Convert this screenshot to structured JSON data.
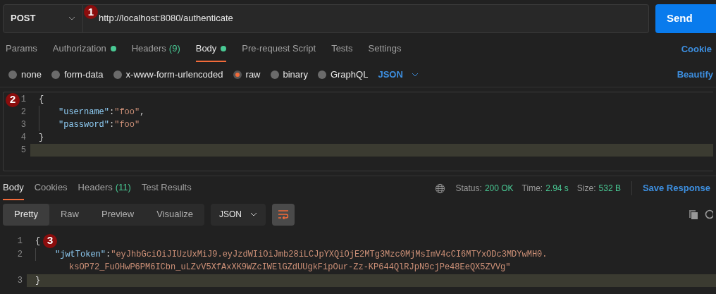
{
  "request": {
    "method": "POST",
    "url": "http://localhost:8080/authenticate",
    "send": "Send"
  },
  "markers": [
    "1",
    "2",
    "3"
  ],
  "request_tabs": [
    {
      "label": "Params",
      "selected": false
    },
    {
      "label": "Authorization",
      "selected": false,
      "dot": true
    },
    {
      "label": "Headers",
      "count": "(9)",
      "selected": false
    },
    {
      "label": "Body",
      "selected": true,
      "dot": true
    },
    {
      "label": "Pre-request Script",
      "selected": false
    },
    {
      "label": "Tests",
      "selected": false
    },
    {
      "label": "Settings",
      "selected": false
    }
  ],
  "cookies_link": "Cookie",
  "body_types": [
    {
      "label": "none",
      "selected": false
    },
    {
      "label": "form-data",
      "selected": false
    },
    {
      "label": "x-www-form-urlencoded",
      "selected": false
    },
    {
      "label": "raw",
      "selected": true
    },
    {
      "label": "binary",
      "selected": false
    },
    {
      "label": "GraphQL",
      "selected": false
    }
  ],
  "language": "JSON",
  "beautify": "Beautify",
  "request_body": [
    {
      "number": "1",
      "current": false,
      "indented": false,
      "tokens": [
        {
          "kind": "punct",
          "text": "{"
        }
      ]
    },
    {
      "number": "2",
      "current": false,
      "indented": true,
      "tokens": [
        {
          "kind": "key",
          "text": "\"username\""
        },
        {
          "kind": "punct",
          "text": ": "
        },
        {
          "kind": "string",
          "text": "\"foo\""
        },
        {
          "kind": "punct",
          "text": ","
        }
      ]
    },
    {
      "number": "3",
      "current": false,
      "indented": true,
      "tokens": [
        {
          "kind": "key",
          "text": "\"password\""
        },
        {
          "kind": "punct",
          "text": ": "
        },
        {
          "kind": "string",
          "text": "\"foo\""
        }
      ]
    },
    {
      "number": "4",
      "current": false,
      "indented": false,
      "tokens": [
        {
          "kind": "punct",
          "text": "}"
        }
      ]
    },
    {
      "number": "5",
      "current": true,
      "indented": false
    }
  ],
  "response_tabs": [
    {
      "label": "Body",
      "selected": true
    },
    {
      "label": "Cookies",
      "selected": false
    },
    {
      "label": "Headers",
      "count": "(11)",
      "selected": false
    },
    {
      "label": "Test Results",
      "selected": false
    }
  ],
  "status": [
    {
      "label": "Status:",
      "value": "200 OK"
    },
    {
      "label": "Time:",
      "value": "2.94 s"
    },
    {
      "label": "Size:",
      "value": "532 B"
    }
  ],
  "save_response": "Save Response",
  "view_modes": [
    {
      "label": "Pretty",
      "selected": true
    },
    {
      "label": "Raw",
      "selected": false
    },
    {
      "label": "Preview",
      "selected": false
    },
    {
      "label": "Visualize",
      "selected": false
    }
  ],
  "response_format": "JSON",
  "response_body": [
    {
      "number": "1",
      "current": false,
      "indented": false,
      "tokens": [
        {
          "kind": "punct",
          "text": "{"
        }
      ]
    },
    {
      "number": "2",
      "current": false,
      "indented": true,
      "tokens": [
        {
          "kind": "key",
          "text": "\"jwtToken\""
        },
        {
          "kind": "punct",
          "text": ": "
        },
        {
          "kind": "string",
          "text": "\"eyJhbGciOiJIUzUxMiJ9.eyJzdWIiOiJmb28iLCJpYXQiOjE2MTg3Mzc0MjMsImV4cCI6MTYxODc3MDYwMH0."
        }
      ],
      "wrap": [
        {
          "kind": "string",
          "text": "ksOP72_FuOHwP6PM6ICbn_uLZvV5XfAxXK9WZcIWElGZdUUgkFipOur-Zz-KP644QlRJpN9cjPe48EeQX5ZVVg\""
        }
      ]
    },
    {
      "number": "3",
      "current": true,
      "indented": false,
      "tokens": [
        {
          "kind": "punct",
          "text": "}"
        }
      ]
    }
  ]
}
